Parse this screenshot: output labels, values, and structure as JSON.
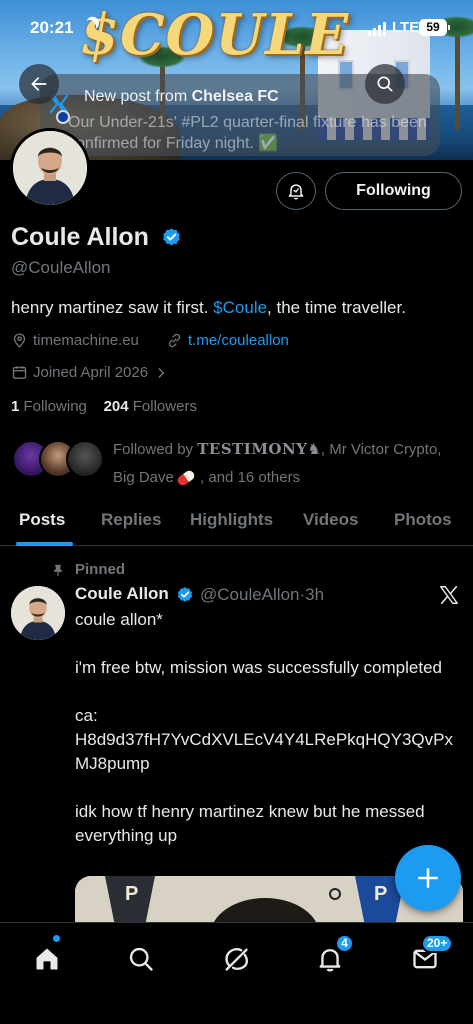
{
  "status_bar": {
    "time": "20:21",
    "network": "LTE",
    "battery": "59"
  },
  "banner": {
    "brand_text": "$COULE"
  },
  "toast": {
    "title_prefix": "New post from ",
    "title_source": "Chelsea FC",
    "body": "Our Under-21s' #PL2 quarter-final fixture has been confirmed for Friday night. ✅"
  },
  "profile": {
    "display_name": "Coule Allon",
    "handle": "@CouleAllon",
    "bio_before": "henry martinez saw it first. ",
    "bio_cashtag": "$Coule",
    "bio_after": ", the time traveller.",
    "website": "timemachine.eu",
    "telegram": "t.me/couleallon",
    "joined": "Joined April 2026",
    "following_count": "1",
    "following_label": "Following",
    "followers_count": "204",
    "followers_label": "Followers",
    "followed_by_prefix": "Followed by ",
    "followed_by_name1": "TESTIMONY",
    "followed_by_rest1": ", Mr Victor Crypto,",
    "followed_by_name3": "Big Dave",
    "followed_by_rest2": " , and 16 others"
  },
  "actions": {
    "following_button": "Following"
  },
  "tabs": [
    {
      "label": "Posts"
    },
    {
      "label": "Replies"
    },
    {
      "label": "Highlights"
    },
    {
      "label": "Videos"
    },
    {
      "label": "Photos"
    }
  ],
  "post": {
    "pinned_label": "Pinned",
    "author_name": "Coule Allon",
    "author_handle": "@CouleAllon",
    "time": "3h",
    "line1": "coule allon*",
    "line2": "i'm free btw, mission was successfully completed",
    "ca_label": "ca:",
    "ca_value": "H8d9d37fH7YvCdXVLEcV4Y4LRePkqHQY3QvPxMJ8pump",
    "line4": "idk how tf henry martinez knew but he messed everything up"
  },
  "nav": {
    "notifications_badge": "4",
    "messages_badge": "20+"
  },
  "colors": {
    "accent": "#1d9bf0",
    "background": "#000000",
    "muted": "#71767b"
  }
}
